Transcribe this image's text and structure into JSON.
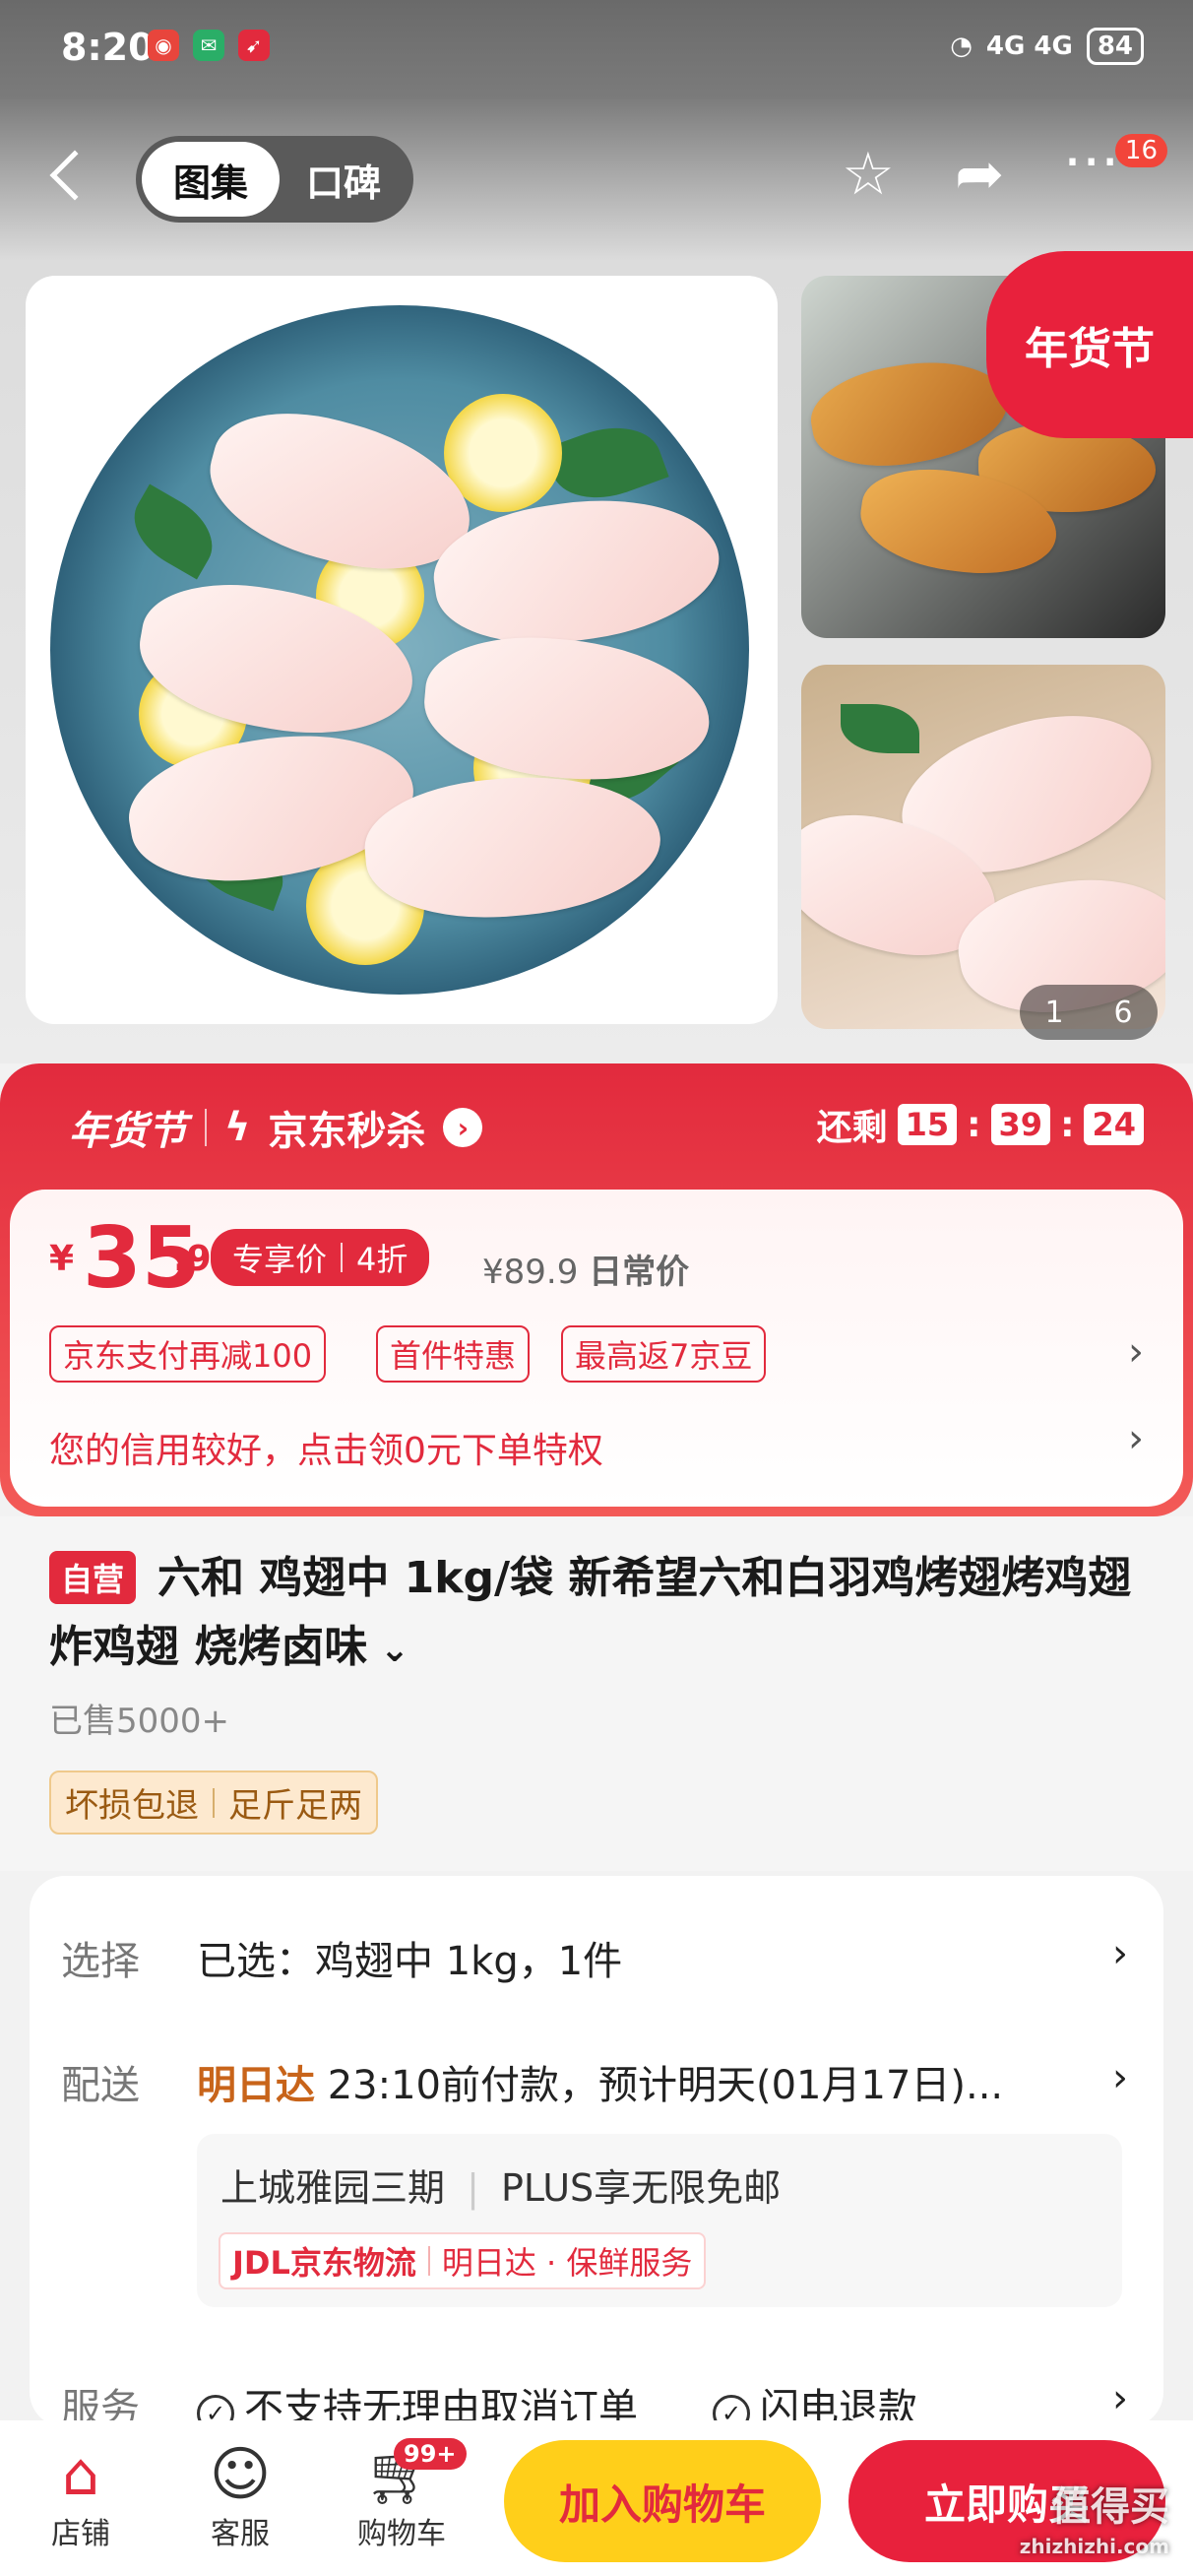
{
  "status_bar": {
    "time": "8:20",
    "network": "4G  4G",
    "battery": "84"
  },
  "header": {
    "tab_gallery": "图集",
    "tab_reviews": "口碑",
    "more_badge": "16"
  },
  "gallery": {
    "festival_badge": "年货节",
    "pager_current": "1",
    "pager_total": "6"
  },
  "promo": {
    "festival": "年货节",
    "seckill": "京东秒杀",
    "remaining_label": "还剩",
    "hours": "15",
    "minutes": "39",
    "seconds": "24"
  },
  "price": {
    "currency": "¥",
    "integer": "35",
    "decimal": ".9",
    "exclusive_label": "专享价",
    "discount": "4折",
    "daily_price": "¥89.9",
    "daily_label": "日常价",
    "tags": [
      "京东支付再减100",
      "首件特惠",
      "最高返7京豆"
    ],
    "credit_text": "您的信用较好，点击领0元下单特权"
  },
  "product": {
    "self_badge": "自营",
    "title": "六和  鸡翅中 1kg/袋 新希望六和白羽鸡烤翅烤鸡翅炸鸡翅 烧烤卤味",
    "sold": "已售5000+",
    "guarantee": [
      "坏损包退",
      "足斤足两"
    ]
  },
  "info": {
    "select_label": "选择",
    "select_value": "已选：鸡翅中 1kg，1件",
    "delivery_label": "配送",
    "delivery_highlight": "明日达",
    "delivery_text": "23:10前付款，预计明天(01月17日)...",
    "address": "上城雅园三期",
    "plus": "PLUS享无限免邮",
    "jdl_logo": "JDL京东物流",
    "jdl_service": "明日达 · 保鲜服务",
    "service_label": "服务",
    "service_items": [
      "不支持无理由取消订单",
      "闪电退款"
    ]
  },
  "bottom_bar": {
    "store": "店铺",
    "service": "客服",
    "cart": "购物车",
    "cart_badge": "99+",
    "add_to_cart": "加入购物车",
    "buy_now": "立即购买"
  },
  "watermark": {
    "main": "值得买",
    "sub": "zhizhizhi.com"
  },
  "colors": {
    "accent": "#e22a3d",
    "cart_button": "#ffcf1a",
    "buy_button": "#e8213c"
  }
}
